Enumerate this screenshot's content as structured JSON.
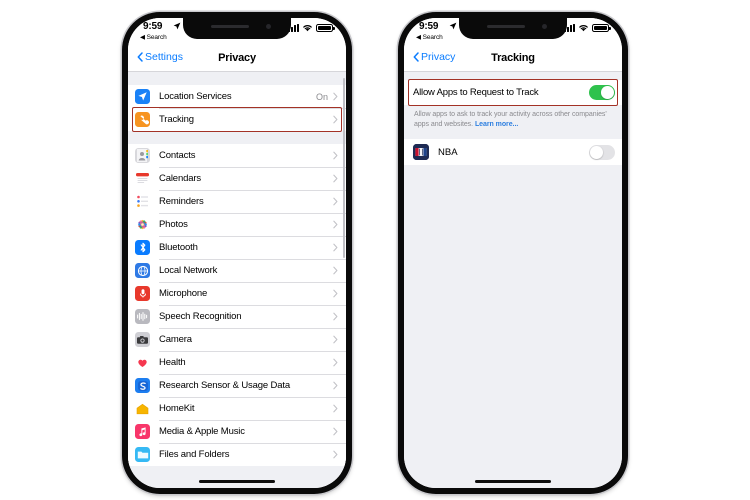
{
  "status_bar": {
    "time": "9:59",
    "back_label": "Search",
    "location_icon": "location-arrow-icon",
    "signal_icon": "cellular-bars-icon",
    "wifi_icon": "wifi-icon",
    "battery_icon": "battery-full-icon"
  },
  "colors": {
    "accent_blue": "#0a7cff",
    "highlight_red": "#a33226",
    "toggle_green": "#2fc24d",
    "link_blue": "#2d7fe0",
    "page_background": "#eff0f4"
  },
  "left_phone": {
    "nav": {
      "back_label": "Settings",
      "title": "Privacy"
    },
    "group_one": [
      {
        "label": "Location Services",
        "value": "On",
        "icon": "location-services-icon",
        "highlighted": false
      },
      {
        "label": "Tracking",
        "value": "",
        "icon": "tracking-icon",
        "highlighted": true
      }
    ],
    "group_two": [
      {
        "label": "Contacts",
        "icon": "contacts-icon"
      },
      {
        "label": "Calendars",
        "icon": "calendars-icon"
      },
      {
        "label": "Reminders",
        "icon": "reminders-icon"
      },
      {
        "label": "Photos",
        "icon": "photos-icon"
      },
      {
        "label": "Bluetooth",
        "icon": "bluetooth-icon"
      },
      {
        "label": "Local Network",
        "icon": "local-network-icon"
      },
      {
        "label": "Microphone",
        "icon": "microphone-icon"
      },
      {
        "label": "Speech Recognition",
        "icon": "speech-recognition-icon"
      },
      {
        "label": "Camera",
        "icon": "camera-icon"
      },
      {
        "label": "Health",
        "icon": "health-icon"
      },
      {
        "label": "Research Sensor & Usage Data",
        "icon": "research-sensor-icon"
      },
      {
        "label": "HomeKit",
        "icon": "homekit-icon"
      },
      {
        "label": "Media & Apple Music",
        "icon": "media-apple-music-icon"
      },
      {
        "label": "Files and Folders",
        "icon": "files-and-folders-icon"
      }
    ]
  },
  "right_phone": {
    "nav": {
      "back_label": "Privacy",
      "title": "Tracking"
    },
    "master_toggle": {
      "label": "Allow Apps to Request to Track",
      "state": "on",
      "highlighted": true
    },
    "footnote": {
      "text": "Allow apps to ask to track your activity across other companies' apps and websites. ",
      "link_label": "Learn more..."
    },
    "apps": [
      {
        "label": "NBA",
        "icon": "nba-app-icon",
        "state": "off"
      }
    ]
  }
}
